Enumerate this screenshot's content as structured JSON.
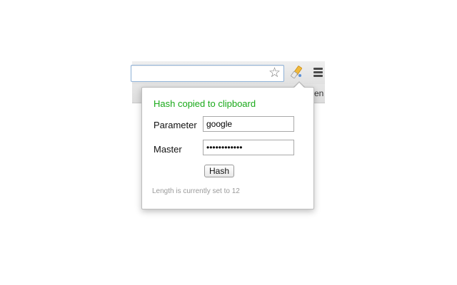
{
  "browser": {
    "bookmark_star_icon": "star-outline-icon",
    "extension_icon": "hash-extension-icon",
    "menu_icon": "hamburger-menu-icon",
    "edge_text": "en"
  },
  "popup": {
    "status": "Hash copied to clipboard",
    "status_color": "#19a919",
    "parameter_label": "Parameter",
    "parameter_value": "google",
    "master_label": "Master",
    "master_value": "••••••••••••",
    "hash_button": "Hash",
    "note": "Length is currently set to 12"
  }
}
